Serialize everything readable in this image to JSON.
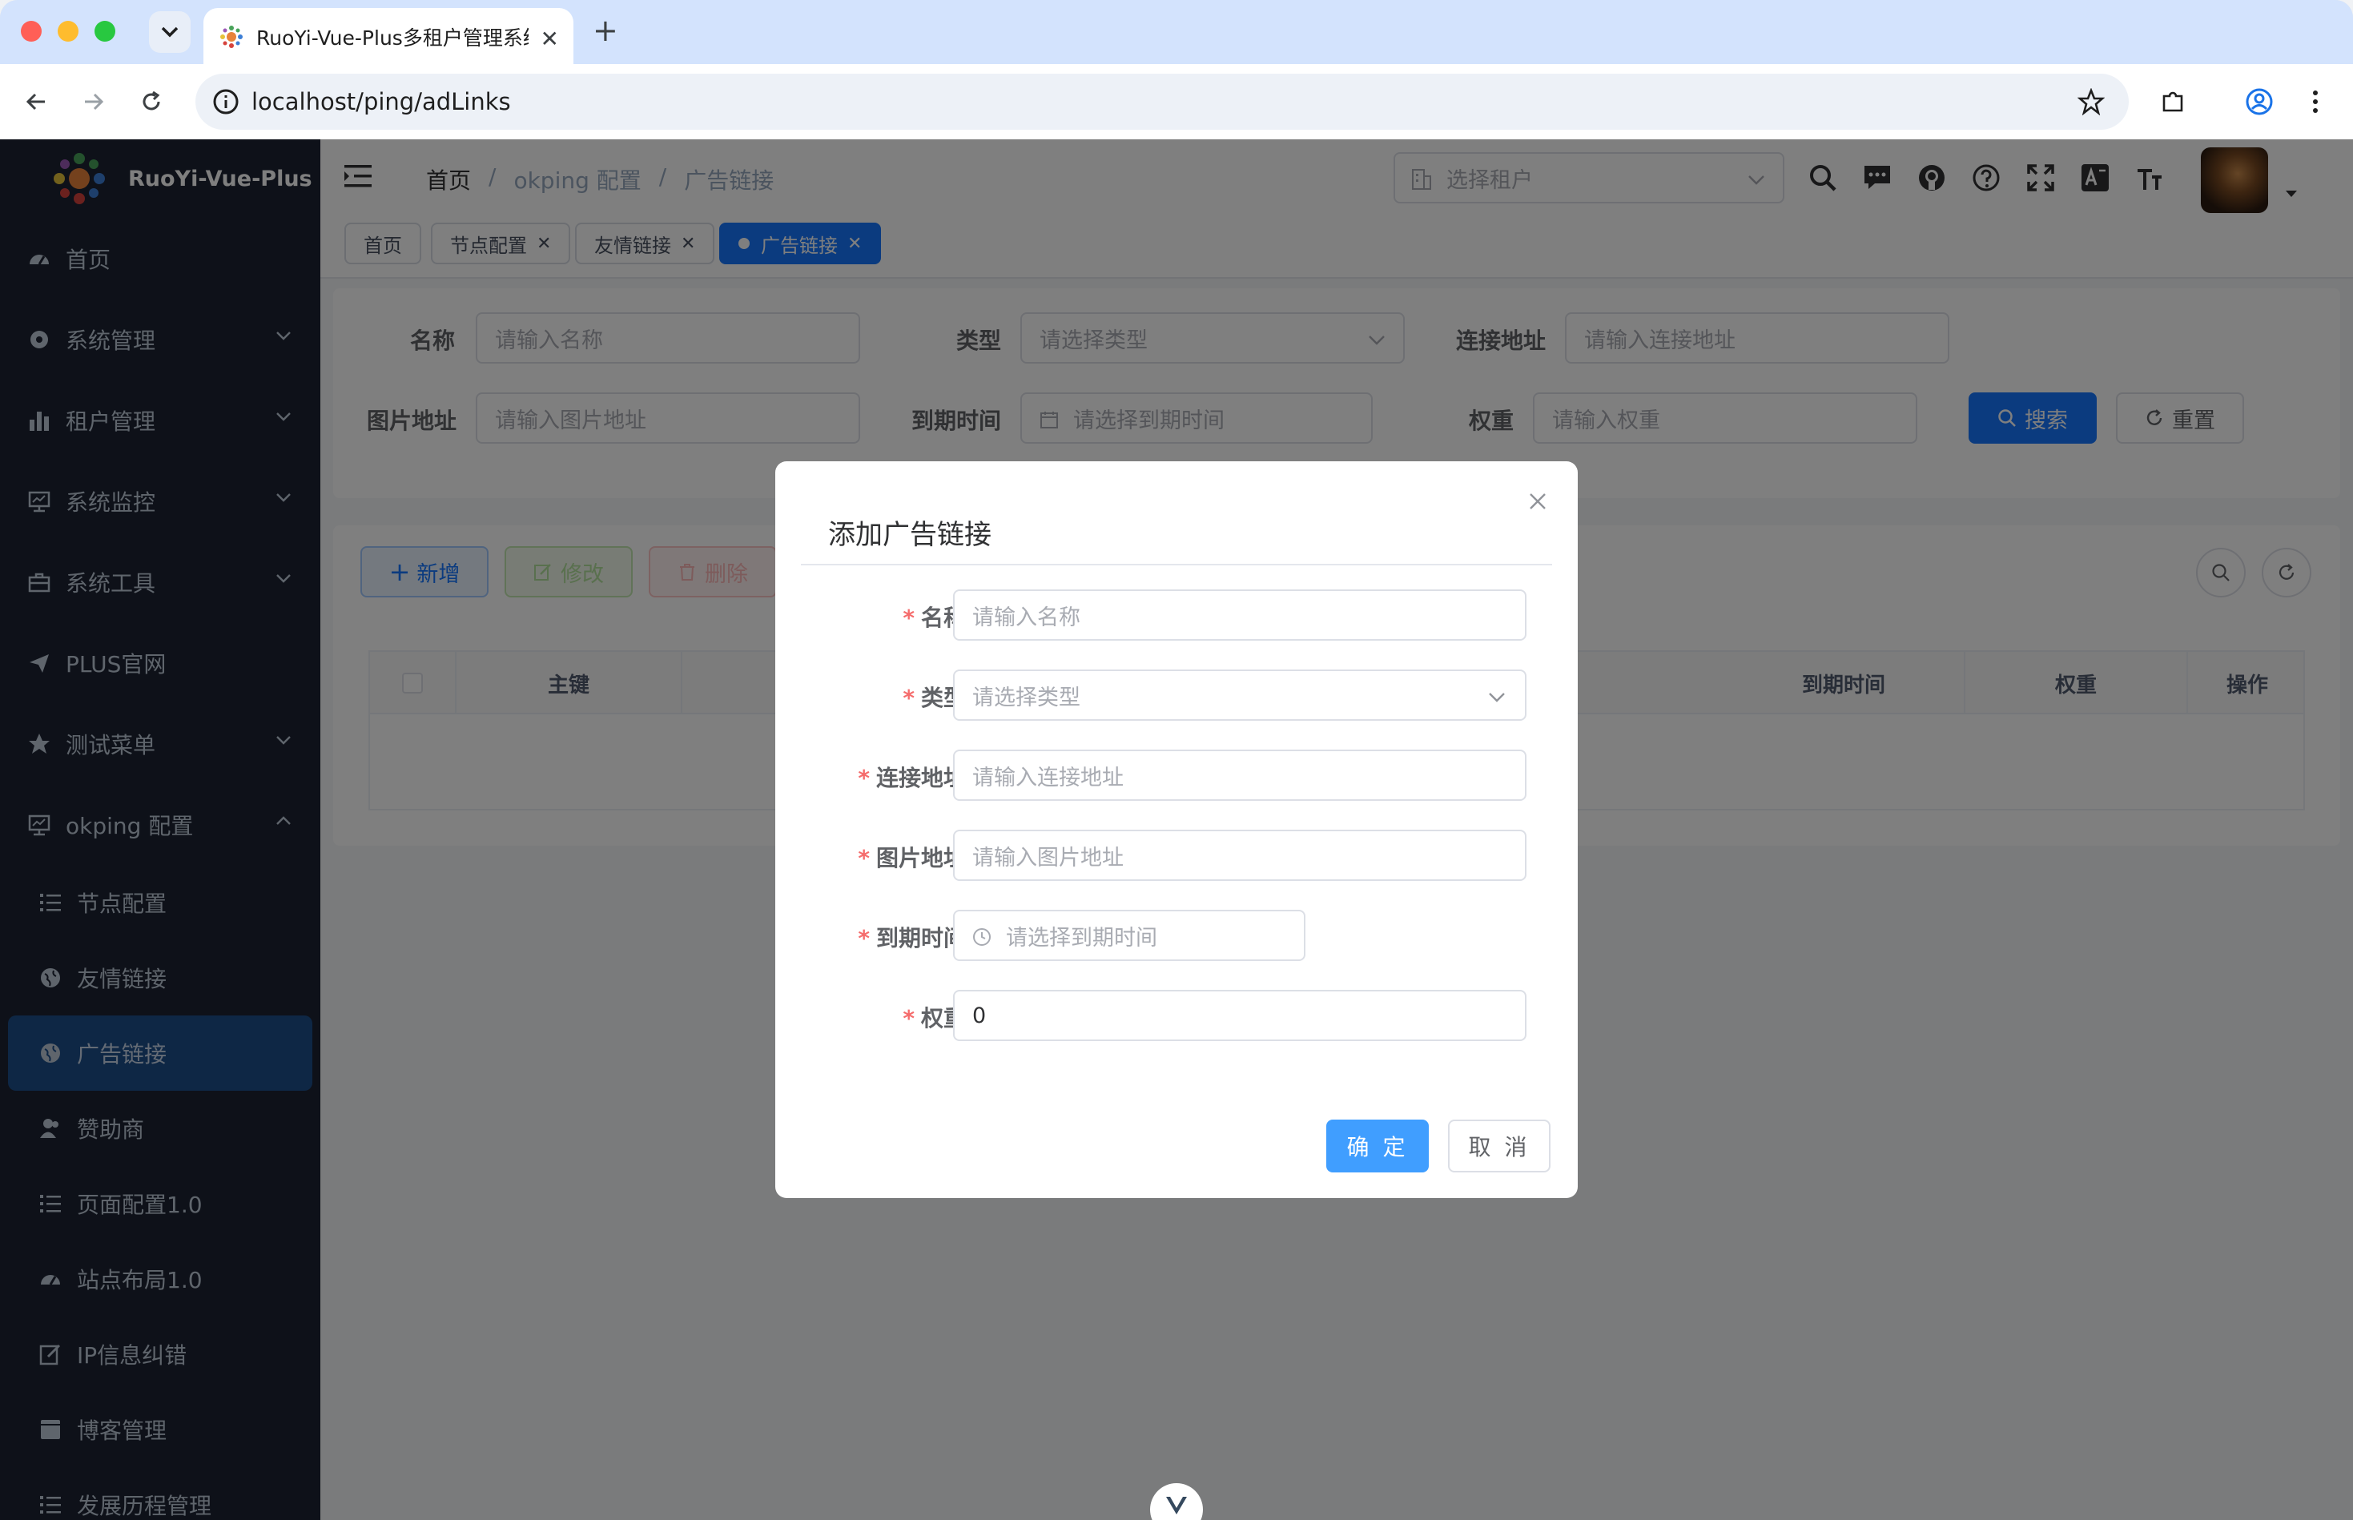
{
  "browser": {
    "tab_title": "RuoYi-Vue-Plus多租户管理系统",
    "url": "localhost/ping/adLinks"
  },
  "app": {
    "logo_text": "RuoYi-Vue-Plus"
  },
  "sidebar": {
    "items": [
      {
        "label": "首页",
        "icon": "dashboard-icon"
      },
      {
        "label": "系统管理",
        "icon": "gear-icon"
      },
      {
        "label": "租户管理",
        "icon": "bar-chart-icon"
      },
      {
        "label": "系统监控",
        "icon": "monitor-icon"
      },
      {
        "label": "系统工具",
        "icon": "toolbox-icon"
      },
      {
        "label": "PLUS官网",
        "icon": "send-icon"
      },
      {
        "label": "测试菜单",
        "icon": "star-icon"
      },
      {
        "label": "okping 配置",
        "icon": "monitor-icon"
      }
    ],
    "sub_items": [
      {
        "label": "节点配置",
        "icon": "list-icon"
      },
      {
        "label": "友情链接",
        "icon": "globe-icon"
      },
      {
        "label": "广告链接",
        "icon": "globe-icon"
      },
      {
        "label": "赞助商",
        "icon": "peoples-icon"
      },
      {
        "label": "页面配置1.0",
        "icon": "list-icon"
      },
      {
        "label": "站点布局1.0",
        "icon": "dashboard-icon"
      },
      {
        "label": "IP信息纠错",
        "icon": "edit-icon"
      },
      {
        "label": "博客管理",
        "icon": "documentation-icon"
      },
      {
        "label": "发展历程管理",
        "icon": "list-icon"
      }
    ]
  },
  "navbar": {
    "breadcrumb": [
      "首页",
      "okping 配置",
      "广告链接"
    ],
    "tenant_placeholder": "选择租户"
  },
  "tags": [
    "首页",
    "节点配置",
    "友情链接",
    "广告链接"
  ],
  "search": {
    "name_label": "名称",
    "name_placeholder": "请输入名称",
    "type_label": "类型",
    "type_placeholder": "请选择类型",
    "url_label": "连接地址",
    "url_placeholder": "请输入连接地址",
    "img_label": "图片地址",
    "img_placeholder": "请输入图片地址",
    "expire_label": "到期时间",
    "expire_placeholder": "请选择到期时间",
    "weight_label": "权重",
    "weight_placeholder": "请输入权重",
    "search_btn": "搜索",
    "reset_btn": "重置"
  },
  "toolbar": {
    "add": "新增",
    "edit": "修改",
    "delete": "删除"
  },
  "table": {
    "columns": [
      "主键",
      "到期时间",
      "权重",
      "操作"
    ]
  },
  "dialog": {
    "title": "添加广告链接",
    "fields": [
      {
        "label": "名称",
        "placeholder": "请输入名称"
      },
      {
        "label": "类型",
        "placeholder": "请选择类型"
      },
      {
        "label": "连接地址",
        "placeholder": "请输入连接地址"
      },
      {
        "label": "图片地址",
        "placeholder": "请输入图片地址"
      },
      {
        "label": "到期时间",
        "placeholder": "请选择到期时间"
      },
      {
        "label": "权重",
        "value": "0"
      }
    ],
    "confirm": "确 定",
    "cancel": "取 消"
  }
}
